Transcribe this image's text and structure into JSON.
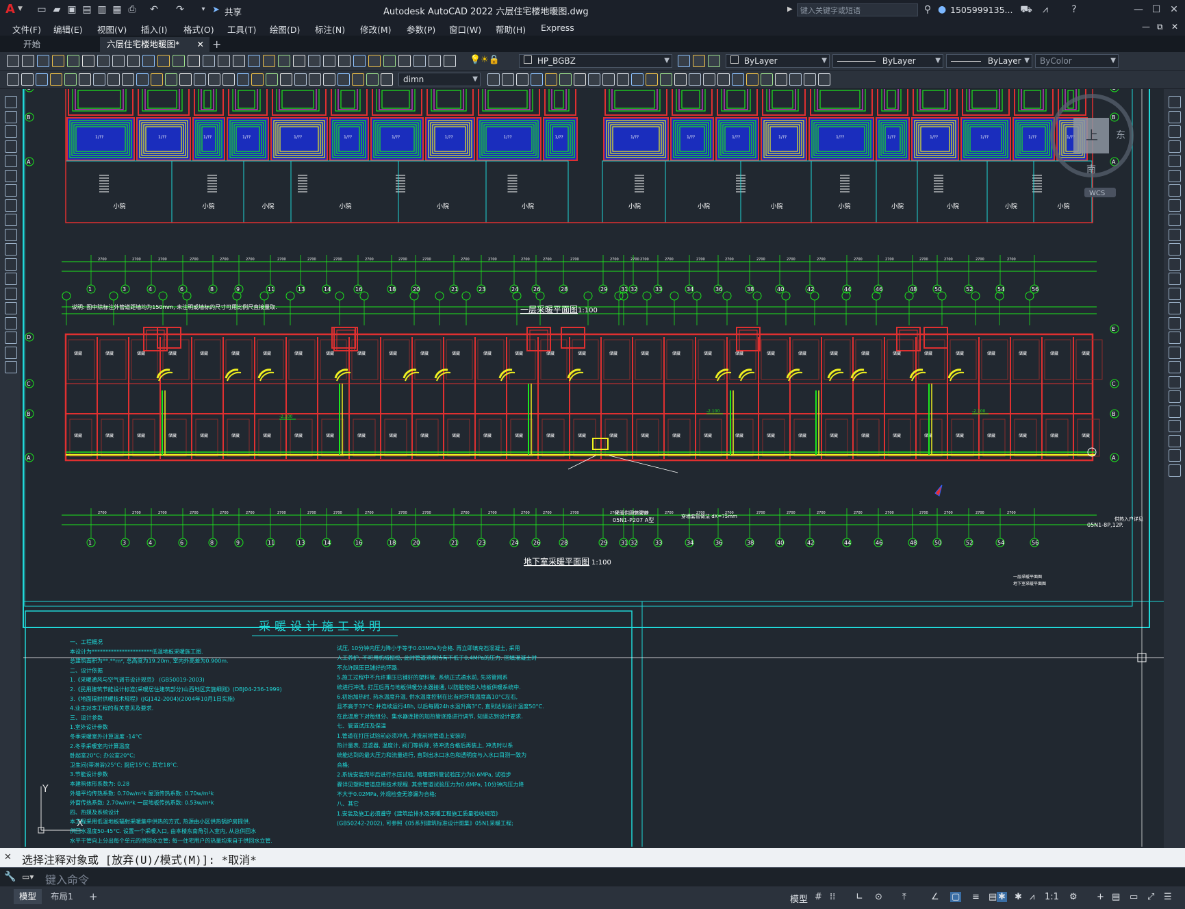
{
  "titlebar": {
    "app_title": "Autodesk AutoCAD 2022    六层住宅楼地暖图.dwg",
    "share_label": "共享",
    "search_placeholder": "键入关键字或短语",
    "user": "1505999135...",
    "logo": "A"
  },
  "menu": {
    "items": [
      "文件(F)",
      "编辑(E)",
      "视图(V)",
      "插入(I)",
      "格式(O)",
      "工具(T)",
      "绘图(D)",
      "标注(N)",
      "修改(M)",
      "参数(P)",
      "窗口(W)",
      "帮助(H)",
      "Express"
    ]
  },
  "tabs": {
    "start": "开始",
    "active": "六层住宅楼地暖图*",
    "add": "+"
  },
  "toolbar": {
    "layer": "HP_BGBZ",
    "color": "ByLayer",
    "linetype": "ByLayer",
    "lineweight": "ByLayer",
    "plotstyle": "ByColor",
    "dimstyle": "dimn"
  },
  "drawing": {
    "plan1_title": "一层采暖平面图",
    "plan2_title": "地下室采暖平面图",
    "scale": "1:100",
    "note": "说明: 图中除标注外管道距墙均为150mm, 未注明或墙标的尺寸可用比例尺直接量取.",
    "room_small": "小院",
    "axis_numbers": [
      "1",
      "3",
      "4",
      "6",
      "8",
      "9",
      "11",
      "13",
      "14",
      "16",
      "18",
      "20",
      "21",
      "23",
      "24",
      "26",
      "28",
      "29",
      "31",
      "32",
      "33",
      "34",
      "36",
      "38",
      "40",
      "42",
      "44",
      "46",
      "48",
      "50",
      "52",
      "54",
      "56"
    ],
    "axis_letters": [
      "A",
      "B",
      "C",
      "D",
      "E"
    ],
    "leader_1": "采暖供回总管道",
    "leader_2": "05N1-P207 A型",
    "leader_3": "穿墙套管做法 dX=75mm",
    "side_note_1": "一层采暖平面图",
    "side_note_2": "地下室采暖平面图",
    "entry_note": "供热入户详见",
    "entry_ref": "05N1-8P,12P.",
    "viewcube_top": "上",
    "viewcube_east": "东",
    "viewcube_south": "南",
    "wcs": "WCS",
    "ucs_y": "Y",
    "ucs_x": "X",
    "spec_title": "采暖设计施工说明",
    "spec_left": [
      "一、工程概况",
      "    本设计为**********************低温地板采暖施工图.",
      "    总建筑面积为**.**m², 总高度为19.20m, 室内外高差为0.900m.",
      "二、设计依据",
      "  1.《采暖通风与空气调节设计规范》 (GB50019-2003)",
      "  2.《民用建筑节能设计标准(采暖居住建筑部分)山西地区实施细则》(DBJ04-236-1999)",
      "  3.《地面辐射供暖技术规程》(JGJ142-2004)(2004年10月1日实施)",
      "  4.业主对本工程的有关意见及要求.",
      "三、设计参数",
      "  1.室外设计参数",
      "    冬季采暖室外计算温度   -14°C",
      "  2.冬季采暖室内计算温度",
      "    卧起室20°C; 办公室20°C;",
      "    卫生间(带淋浴)25°C; 厨房15°C; 其它18°C.",
      "  3.节能设计参数",
      "    本建筑体形系数为: 0.28",
      "    外墙平均传热系数: 0.70w/m²k     屋顶传热系数: 0.70w/m²k",
      "    外窗传热系数: 2.70w/m²k        一层地板传热系数: 0.53w/m²k",
      "四、热媒及系统设计",
      "    本工程采用低温地板辐射采暖集中供热的方式, 热源由小区供热锅炉房提供.",
      "  供回水温度50-45°C. 设置一个采暖入口, 由本楼东南角引入室内, 从总供回水",
      "  水平干管向上分出每个单元的供回水立管; 每一住宅用户的热量均来自于供回水立管."
    ],
    "spec_right": [
      "试压, 10分钟内压力降小于等于0.03MPa为合格. 再立即填充石混凝土, 采用",
      "人工养护, 不可用机械振捣, 此时管道须保持有不低于0.4MPa的压力. 回填混凝土时",
      "不允许踩压已铺好的环路.",
      "  5.施工过程中不允许重压已铺好的塑料管. 系统正式通水前, 先将管网系",
      "统进行冲洗, 打压后再与地板供暖分水器接通, 以防脏物进入地板供暖系统中.",
      "  6.初始加热时, 热水温度升温, 供水温度控制在比当时环境温度高10°C左右,",
      "且不高于32°C; 并连续运行48h, 以后每隔24h水温升高3°C, 直到达到设计温度50°C.",
      "在此温度下对每组分、集水器连接的加热管逐路进行调节, 知道达到设计要求.",
      "七、管道试压及保温",
      "  1.管道在打压试验前必须冲洗, 冲洗前将管道上安装的",
      "热计量表, 过滤器, 温度计, 阀门等拆除, 待冲洗合格后再装上, 冲洗时以系",
      "统能达到的最大压力和流量进行, 直到出水口水色和透明度与入水口目测一致为",
      "合格;",
      "  2.系统安装完毕后进行水压试验, 暗埋塑料管试验压力为0.6MPa, 试验步",
      "骤详见塑料管道应用技术规程. 其余管道试验压力为0.6MPa, 10分钟内压力降",
      "不大于0.02MPa, 外观检查无渗漏为合格;",
      "八、其它",
      "  1.安装及施工必须遵守《建筑给排水及采暖工程施工质量验收规范》",
      "(GB50242-2002), 可参照《05系列建筑标准设计图集》05N1采暖工程;"
    ]
  },
  "command": {
    "history": "选择注释对象或 [放弃(U)/模式(M)]: *取消*",
    "input_placeholder": "键入命令"
  },
  "status": {
    "model_tab": "模型",
    "layout_tab": "布局1",
    "add_tab": "+",
    "model_label": "模型",
    "scale": "1:1"
  },
  "colors": {
    "background": "#212830",
    "green": "#1de81d",
    "red": "#e03030",
    "yellow": "#f0f020",
    "blue": "#1a2dbd",
    "cyan": "#20d8d8",
    "magenta": "#e040e0"
  }
}
